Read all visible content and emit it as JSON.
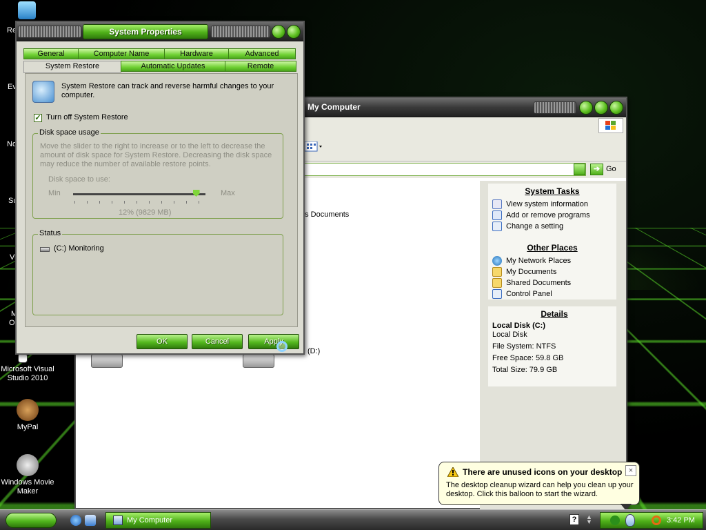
{
  "desktop": {
    "icons": [
      {
        "label": "Microsoft Visual Studio 2010"
      },
      {
        "label": "MyPal"
      },
      {
        "label": "Windows Movie Maker"
      }
    ],
    "edge_labels": [
      "Re",
      "Ev",
      "No",
      "Su",
      "Vi",
      "M",
      "O"
    ]
  },
  "sysprops": {
    "title": "System Properties",
    "tabs_row1": [
      "General",
      "Computer Name",
      "Hardware",
      "Advanced"
    ],
    "tabs_row2": [
      "System Restore",
      "Automatic Updates",
      "Remote"
    ],
    "intro": "System Restore can track and reverse harmful changes to your computer.",
    "checkbox_label": "Turn off System Restore",
    "checkbox_checked": true,
    "disk_group": "Disk space usage",
    "disk_desc": "Move the slider to the right to increase or to the left to decrease the amount of disk space for System Restore. Decreasing the disk space may reduce the number of available restore points.",
    "slider_label": "Disk space to use:",
    "slider_min": "Min",
    "slider_max": "Max",
    "slider_value": "12% (9829 MB)",
    "slider_level": 0.93,
    "status_group": "Status",
    "status_item": "(C:)  Monitoring",
    "buttons": {
      "ok": "OK",
      "cancel": "Cancel",
      "apply": "Apply"
    }
  },
  "mycomputer": {
    "title": "My Computer",
    "go_label": "Go",
    "partial_texts": {
      "documents": "'s Documents",
      "drive": "(D:)"
    },
    "system_tasks": {
      "title": "System Tasks",
      "items": [
        "View system information",
        "Add or remove programs",
        "Change a setting"
      ]
    },
    "other_places": {
      "title": "Other Places",
      "items": [
        "My Network Places",
        "My Documents",
        "Shared Documents",
        "Control Panel"
      ]
    },
    "details": {
      "title": "Details",
      "name": "Local Disk (C:)",
      "type": "Local Disk",
      "filesystem": "File System: NTFS",
      "free": "Free Space: 59.8 GB",
      "total": "Total Size: 79.9 GB"
    }
  },
  "balloon": {
    "title": "There are unused icons on your desktop",
    "body": "The desktop cleanup wizard can help you clean up your desktop. Click this balloon to start the wizard.",
    "close": "×"
  },
  "taskbar": {
    "task_label": "My Computer",
    "clock": "3:42 PM",
    "help_glyph": "?"
  }
}
